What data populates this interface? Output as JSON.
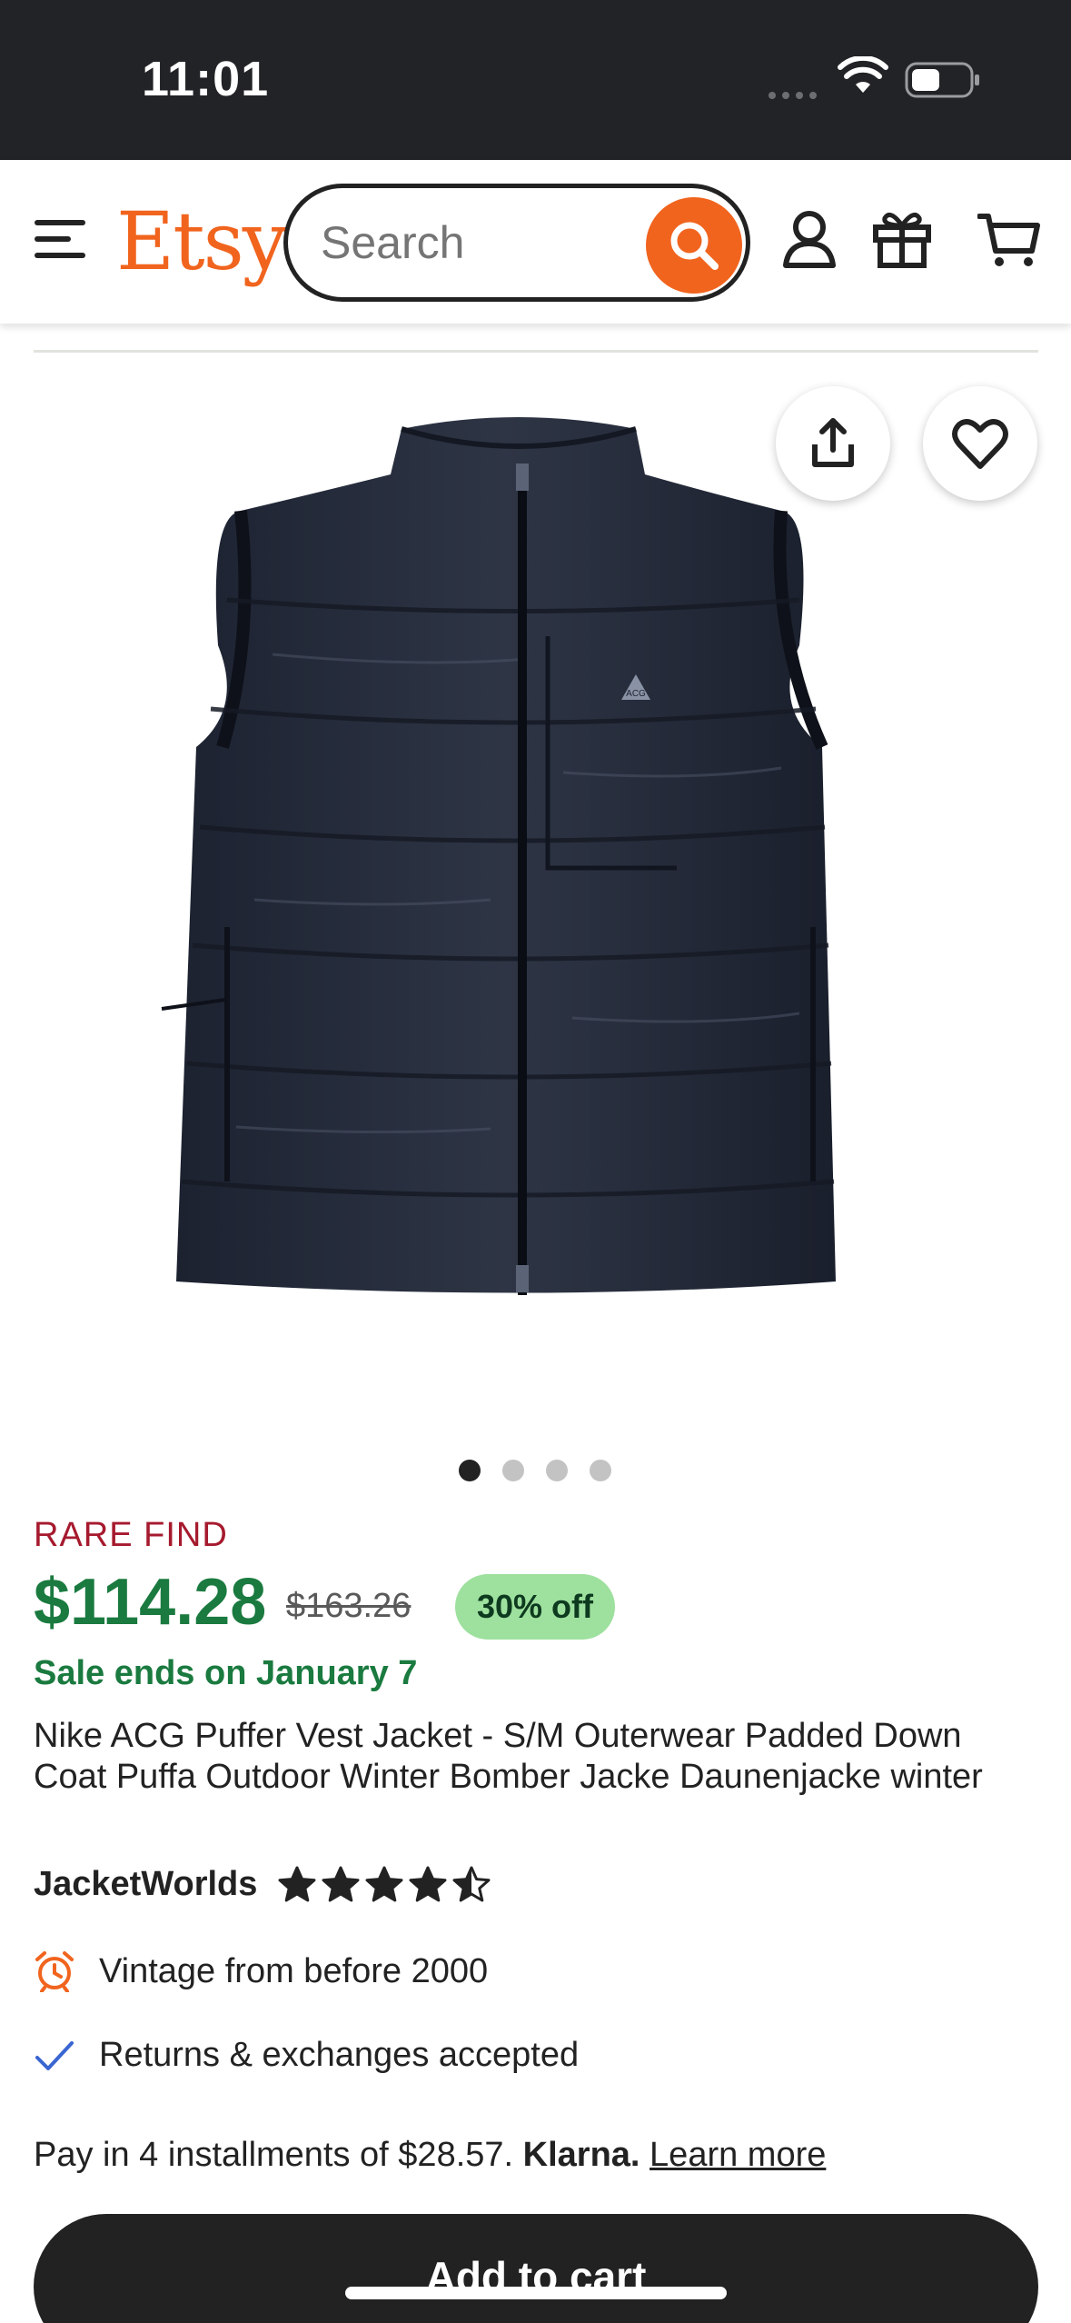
{
  "status_bar": {
    "time": "11:01"
  },
  "header": {
    "logo": "Etsy",
    "search": {
      "placeholder": "Search",
      "value": ""
    },
    "icons": [
      "menu-icon",
      "search-icon",
      "account-icon",
      "gift-icon",
      "cart-icon"
    ]
  },
  "colors": {
    "brand": "#f1641e",
    "price_green": "#1a7a3f",
    "rare_find_red": "#a61a2e",
    "badge_green": "#9ee09e",
    "primary_button": "#222222"
  },
  "gallery": {
    "image_alt": "Navy Nike ACG puffer vest",
    "current_index": 1,
    "total": 4,
    "share_icon": "share-icon",
    "favorite_icon": "heart-icon"
  },
  "listing": {
    "badge": "RARE FIND",
    "price": "$114.28",
    "original_price": "$163.26",
    "discount": "30% off",
    "sale_ends": "Sale ends on January 7",
    "title": "Nike ACG Puffer Vest Jacket - S/M Outerwear Padded Down Coat Puffa Outdoor Winter Bomber Jacke Daunenjacke winter",
    "shop_name": "JacketWorlds",
    "rating": 4.5,
    "rating_max": 5
  },
  "features": [
    {
      "icon": "alarm-clock-icon",
      "text": "Vintage from before 2000"
    },
    {
      "icon": "checkmark-icon",
      "text": "Returns & exchanges accepted"
    }
  ],
  "payment": {
    "installments_text": "Pay in 4 installments of $28.57.",
    "provider": "Klarna.",
    "learn_more": "Learn more"
  },
  "actions": {
    "add_to_cart": "Add to cart"
  }
}
